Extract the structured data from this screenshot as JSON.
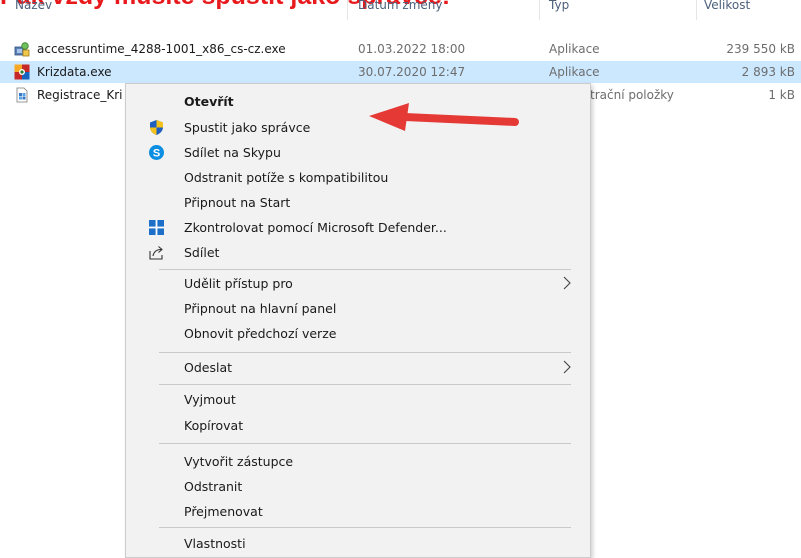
{
  "banner": {
    "text": "Pak vždy musíte spustit jako správce!"
  },
  "header": {
    "name": "Název",
    "date": "Datum změny",
    "type": "Typ",
    "size": "Velikost"
  },
  "files": [
    {
      "name": "accessruntime_4288-1001_x86_cs-cz.exe",
      "date": "01.03.2022 18:00",
      "type": "Aplikace",
      "size": "239 550 kB",
      "icon": "installer-icon"
    },
    {
      "name": "Krizdata.exe",
      "date": "30.07.2020 12:47",
      "type": "Aplikace",
      "size": "2 893 kB",
      "icon": "krizdata-app-icon",
      "selected": true
    },
    {
      "name": "Registrace_Kri",
      "date": "",
      "type": "trační položky",
      "size": "1 kB",
      "icon": "registry-icon"
    }
  ],
  "menu": {
    "open": "Otevřít",
    "run_as_admin": "Spustit jako správce",
    "share_skype": "Sdílet na Skypu",
    "troubleshoot": "Odstranit potíže s kompatibilitou",
    "pin_start": "Připnout na Start",
    "defender": "Zkontrolovat pomocí Microsoft Defender...",
    "share": "Sdílet",
    "give_access": "Udělit přístup pro",
    "pin_taskbar": "Připnout na hlavní panel",
    "restore_versions": "Obnovit předchozí verze",
    "send_to": "Odeslat",
    "cut": "Vyjmout",
    "copy": "Kopírovat",
    "create_shortcut": "Vytvořit zástupce",
    "delete": "Odstranit",
    "rename": "Přejmenovat",
    "properties": "Vlastnosti"
  },
  "colors": {
    "banner": "#e8191c",
    "selection": "#cce8ff",
    "menu_bg": "#f2f2f2",
    "arrow": "#e53935"
  }
}
